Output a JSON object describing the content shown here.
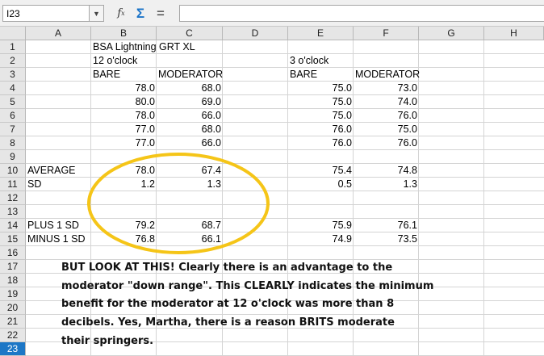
{
  "formula_bar": {
    "name_box": "I23",
    "input": "",
    "function_wizard_icon": "fx-icon",
    "sum_icon": "sigma-icon",
    "formula_icon": "equals-icon"
  },
  "columns": [
    "A",
    "B",
    "C",
    "D",
    "E",
    "F",
    "G",
    "H"
  ],
  "rows": [
    "1",
    "2",
    "3",
    "4",
    "5",
    "6",
    "7",
    "8",
    "9",
    "10",
    "11",
    "12",
    "13",
    "14",
    "15",
    "16",
    "17",
    "18",
    "19",
    "20",
    "21",
    "22",
    "23"
  ],
  "active_row": "23",
  "sheet": {
    "title": "BSA Lightning GRT XL",
    "group_12": "12 o'clock",
    "group_3": "3 o'clock",
    "bare_12": "BARE",
    "mod_12": "MODERATOR",
    "bare_3": "BARE",
    "mod_3": "MODERATOR",
    "data": [
      [
        "78.0",
        "68.0",
        "75.0",
        "73.0"
      ],
      [
        "80.0",
        "69.0",
        "75.0",
        "74.0"
      ],
      [
        "78.0",
        "66.0",
        "75.0",
        "76.0"
      ],
      [
        "77.0",
        "68.0",
        "76.0",
        "75.0"
      ],
      [
        "77.0",
        "66.0",
        "76.0",
        "76.0"
      ]
    ],
    "average": {
      "label": "AVERAGE",
      "values": [
        "78.0",
        "67.4",
        "75.4",
        "74.8"
      ]
    },
    "sd": {
      "label": "SD",
      "values": [
        "1.2",
        "1.3",
        "0.5",
        "1.3"
      ]
    },
    "plus": {
      "label": "PLUS 1 SD",
      "values": [
        "79.2",
        "68.7",
        "75.9",
        "76.1"
      ]
    },
    "minus": {
      "label": "MINUS 1 SD",
      "values": [
        "76.8",
        "66.1",
        "74.9",
        "73.5"
      ]
    }
  },
  "annotation": {
    "lines": [
      "BUT LOOK AT THIS!  Clearly there is an advantage to the",
      "moderator \"down range\".  This CLEARLY indicates the minimum",
      "benefit for the moderator at 12 o'clock was more than 8",
      "decibels.   Yes, Martha, there is a reason BRITS moderate",
      "their springers."
    ],
    "oval_color": "#f5c518"
  }
}
